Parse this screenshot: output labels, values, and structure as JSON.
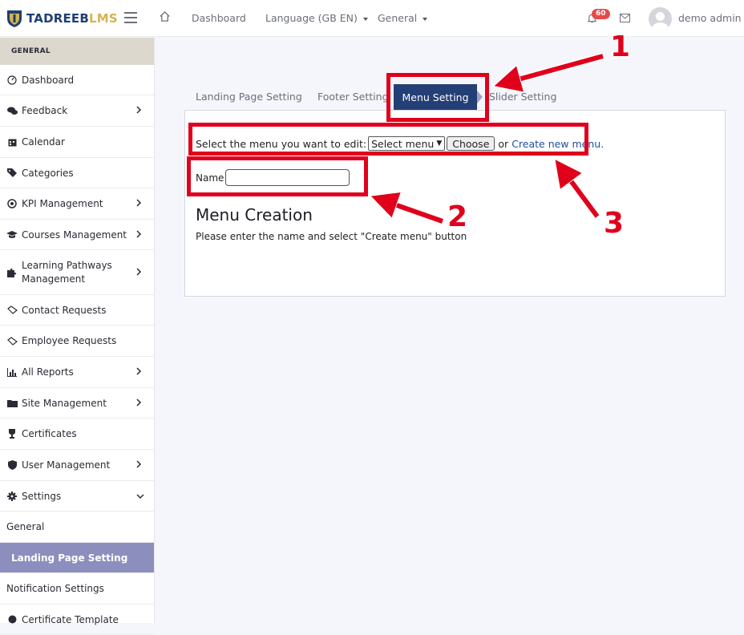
{
  "brand": {
    "name_part1": "TADREEB",
    "name_part2": "LMS"
  },
  "topnav": {
    "dashboard": "Dashboard",
    "language": "Language (GB EN)",
    "general": "General",
    "notification_count": "60",
    "user_name": "demo admin"
  },
  "sidebar": {
    "header": "GENERAL",
    "items": [
      {
        "label": "Dashboard",
        "icon": "gauge-icon",
        "chevron": false
      },
      {
        "label": "Feedback",
        "icon": "comments-icon",
        "chevron": true
      },
      {
        "label": "Calendar",
        "icon": "calendar-icon",
        "chevron": false
      },
      {
        "label": "Categories",
        "icon": "tags-icon",
        "chevron": false
      },
      {
        "label": "KPI Management",
        "icon": "target-icon",
        "chevron": true
      },
      {
        "label": "Courses Management",
        "icon": "graduation-cap-icon",
        "chevron": true
      },
      {
        "label": "Learning Pathways Management",
        "icon": "puzzle-icon",
        "chevron": true
      },
      {
        "label": "Contact Requests",
        "icon": "handshake-icon",
        "chevron": false
      },
      {
        "label": "Employee Requests",
        "icon": "handshake-icon",
        "chevron": false
      },
      {
        "label": "All Reports",
        "icon": "bar-chart-icon",
        "chevron": true
      },
      {
        "label": "Site Management",
        "icon": "folder-icon",
        "chevron": true
      },
      {
        "label": "Certificates",
        "icon": "trophy-icon",
        "chevron": false
      },
      {
        "label": "User Management",
        "icon": "shield-icon",
        "chevron": true
      },
      {
        "label": "Settings",
        "icon": "gear-icon",
        "chevron": true
      }
    ],
    "sub_general": "General",
    "sub_landing": "Landing Page Setting",
    "sub_notification": "Notification Settings",
    "sub_certificate": "Certificate Template"
  },
  "tabs": {
    "landing": "Landing Page Setting",
    "footer": "Footer Setting",
    "menu": "Menu Setting",
    "slider": "Slider Setting"
  },
  "menu_editor": {
    "select_prompt": "Select the menu you want to edit:",
    "select_value": "Select menu",
    "choose_button": "Choose",
    "or_text": "or",
    "create_link": "Create new menu.",
    "name_label": "Name",
    "name_value": "",
    "heading": "Menu Creation",
    "description": "Please enter the name and select \"Create menu\" button"
  },
  "annotations": {
    "one": "1",
    "two": "2",
    "three": "3"
  },
  "colors": {
    "accent": "#233f75",
    "annotation": "#e0001b",
    "active_sidebar": "#8c8fbd"
  }
}
